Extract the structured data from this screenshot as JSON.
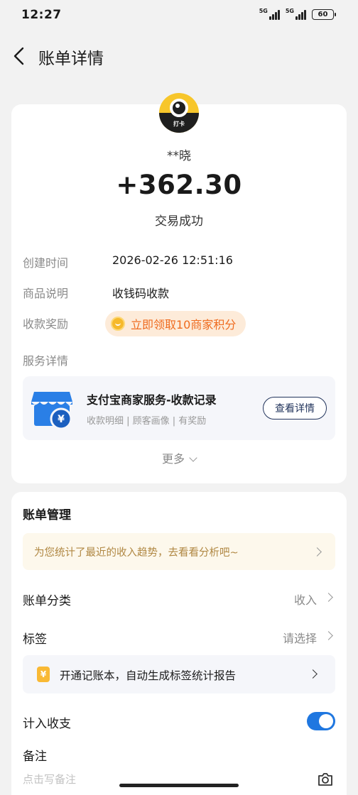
{
  "status_bar": {
    "time": "12:27",
    "network_1": "5G",
    "network_2": "5G",
    "battery": "60"
  },
  "header": {
    "title": "账单详情"
  },
  "detail": {
    "avatar_text": "打卡",
    "payer_name": "**晓",
    "amount": "+362.30",
    "status": "交易成功",
    "rows": [
      {
        "label": "创建时间",
        "value": "2026-02-26 12:51:16"
      },
      {
        "label": "商品说明",
        "value": "收钱码收款"
      },
      {
        "label": "收款奖励",
        "value": "立即领取10商家积分"
      },
      {
        "label": "服务详情"
      }
    ],
    "service": {
      "title": "支付宝商家服务-收款记录",
      "subtitle": "收款明细 | 顾客画像 | 有奖励",
      "button": "查看详情"
    },
    "more": "更多"
  },
  "manage": {
    "title": "账单管理",
    "analysis_banner": "为您统计了最近的收入趋势，去看看分析吧~",
    "category_label": "账单分类",
    "category_value": "收入",
    "tag_label": "标签",
    "tag_value": "请选择",
    "notebook_banner": "开通记账本，自动生成标签统计报告",
    "notebook_icon": "¥",
    "include_label": "计入收支",
    "include_on": true,
    "remark_label": "备注",
    "remark_placeholder": "点击写备注"
  },
  "colors": {
    "accent_blue": "#1f77e0",
    "reward_orange": "#ef6b1f",
    "analysis_gold": "#b08742"
  }
}
